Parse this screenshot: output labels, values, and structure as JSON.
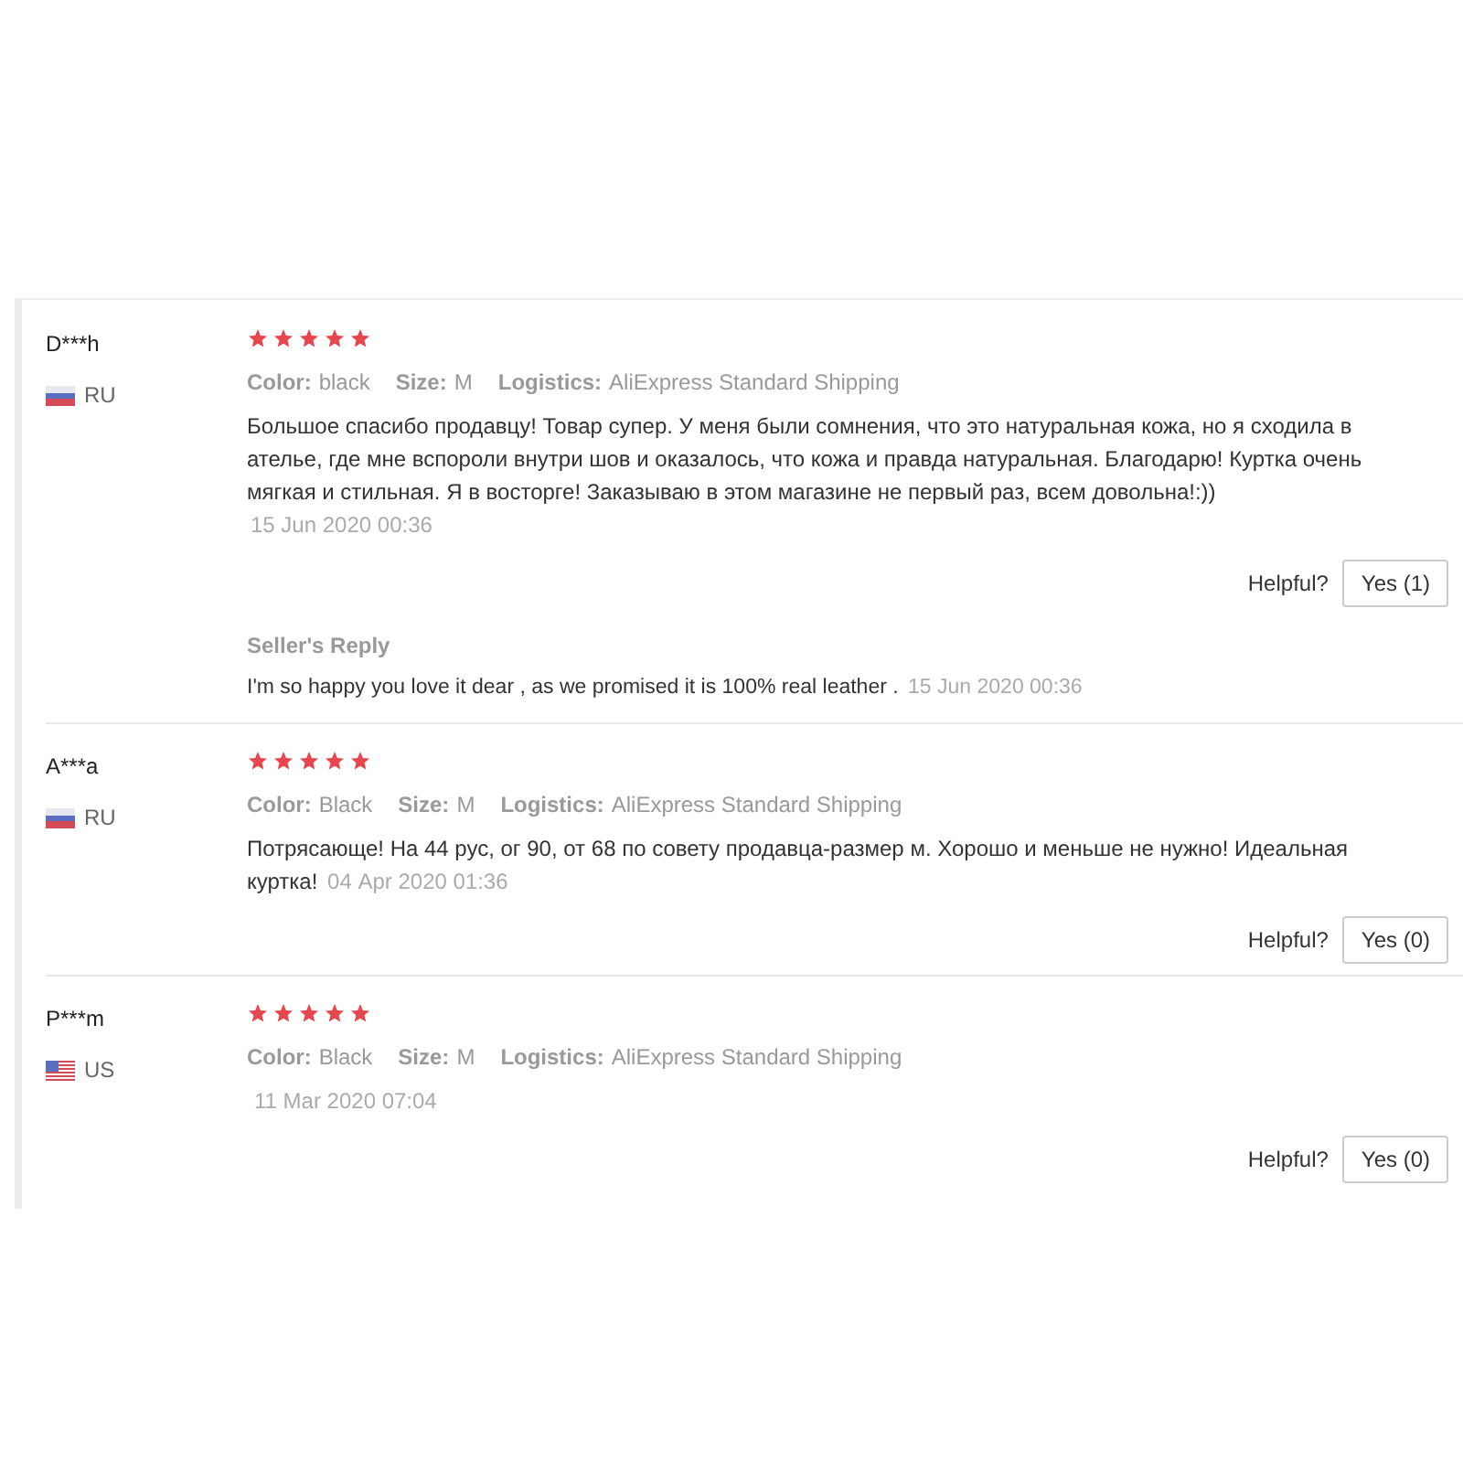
{
  "reviews": [
    {
      "user": "D***h",
      "kind": "ru",
      "country": "RU",
      "stars": 5,
      "attributes": [
        {
          "label": "Color:",
          "value": "black"
        },
        {
          "label": "Size:",
          "value": "M"
        },
        {
          "label": "Logistics:",
          "value": "AliExpress Standard Shipping"
        }
      ],
      "text": "Большое спасибо продавцу! Товар супер. У меня были сомнения, что это натуральная кожа, но я сходила в ателье, где мне вспороли внутри шов и оказалось, что кожа и правда натуральная. Благодарю! Куртка очень мягкая и стильная. Я в восторге! Заказываю в этом магазине не первый раз, всем довольна!:))",
      "date": "15 Jun 2020 00:36",
      "helpful_label": "Helpful?",
      "yes_button": "Yes (1)",
      "seller_reply": {
        "title": "Seller's Reply",
        "text": "I'm so happy you love it dear , as we promised it is 100% real leather .",
        "date": "15 Jun 2020 00:36"
      }
    },
    {
      "user": "A***a",
      "kind": "ru",
      "country": "RU",
      "stars": 5,
      "attributes": [
        {
          "label": "Color:",
          "value": "Black"
        },
        {
          "label": "Size:",
          "value": "M"
        },
        {
          "label": "Logistics:",
          "value": "AliExpress Standard Shipping"
        }
      ],
      "text": "Потрясающе! На 44 рус, ог 90, от 68 по совету продавца-размер м. Хорошо и меньше не нужно! Идеальная куртка!",
      "date": "04 Apr 2020 01:36",
      "helpful_label": "Helpful?",
      "yes_button": "Yes (0)"
    },
    {
      "user": "P***m",
      "kind": "us",
      "country": "US",
      "stars": 5,
      "attributes": [
        {
          "label": "Color:",
          "value": "Black"
        },
        {
          "label": "Size:",
          "value": "M"
        },
        {
          "label": "Logistics:",
          "value": "AliExpress Standard Shipping"
        }
      ],
      "date": "11 Mar 2020 07:04",
      "helpful_label": "Helpful?",
      "yes_button": "Yes (0)"
    }
  ]
}
